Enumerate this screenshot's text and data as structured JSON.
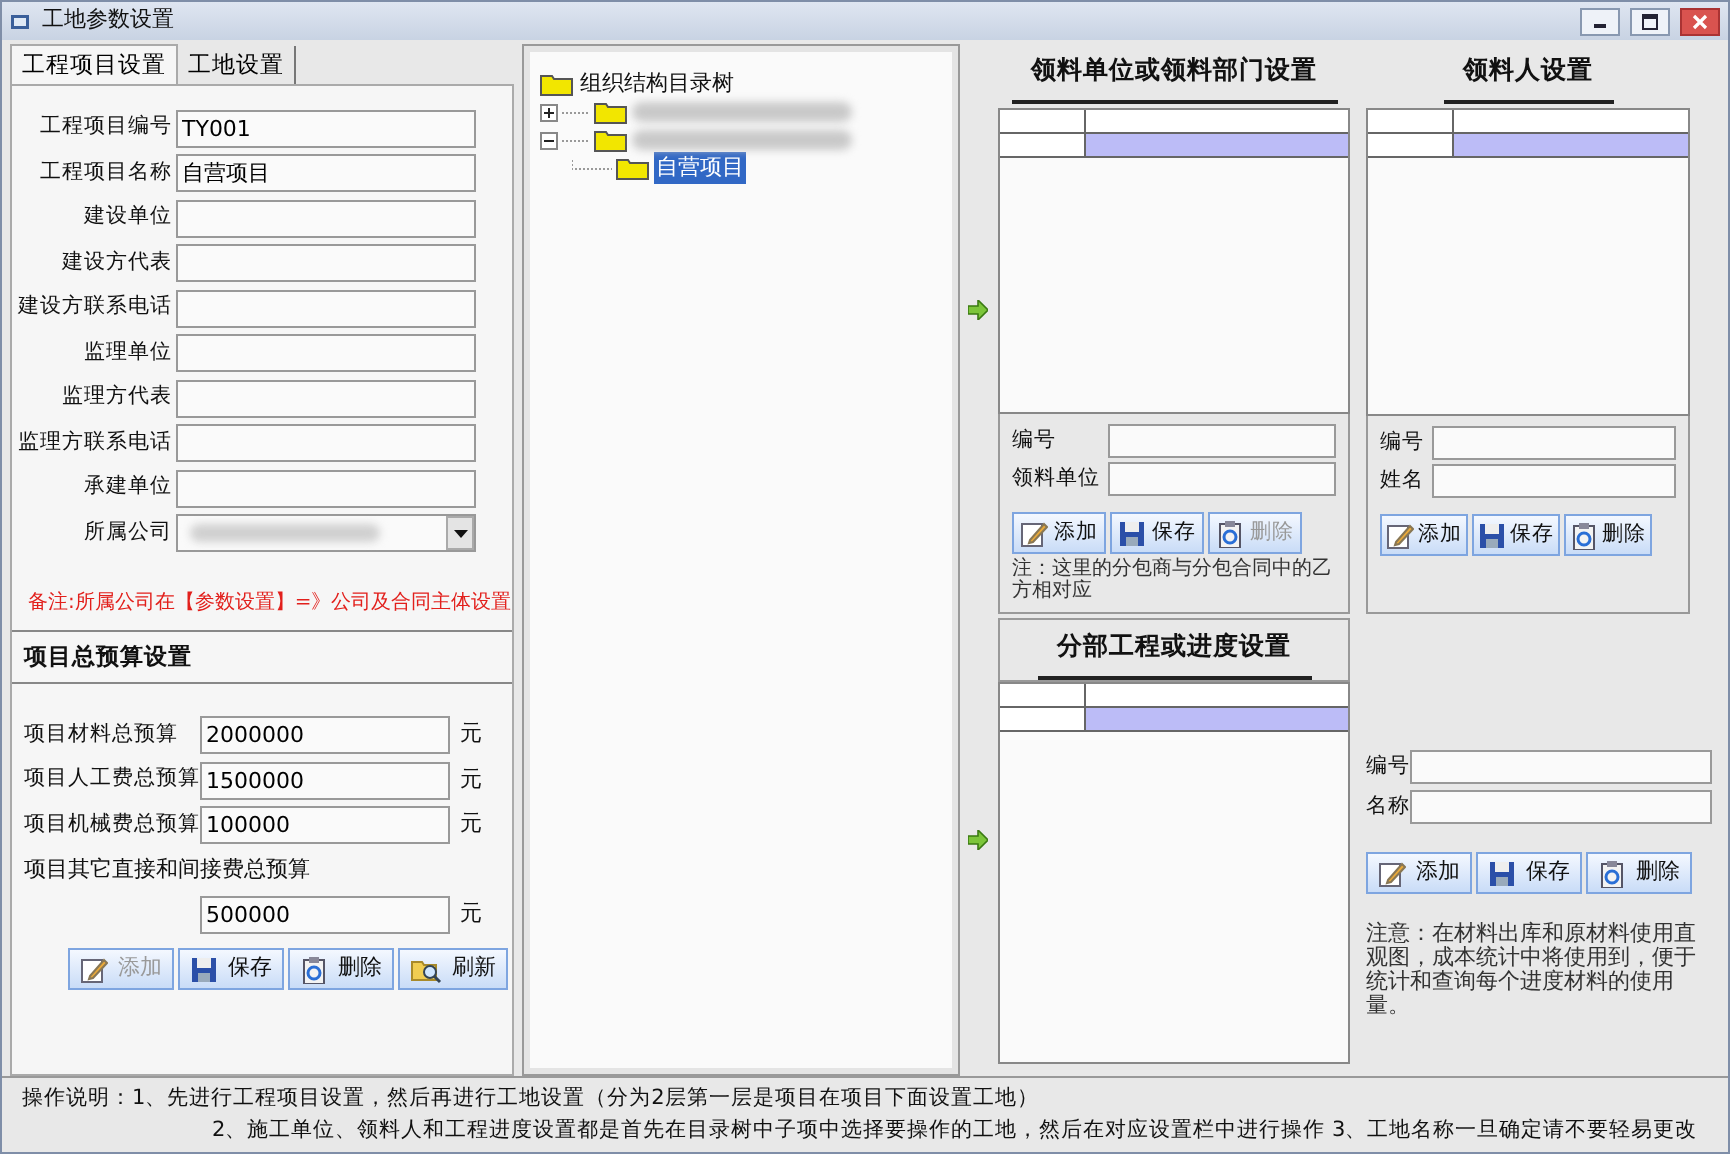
{
  "window": {
    "title": "工地参数设置"
  },
  "tabs": [
    {
      "label": "工程项目设置",
      "selected": true
    },
    {
      "label": "工地设置",
      "selected": false
    }
  ],
  "project_form": [
    {
      "label": "工程项目编号",
      "value": "TY001",
      "kind": "text"
    },
    {
      "label": "工程项目名称",
      "value": "自营项目",
      "kind": "text"
    },
    {
      "label": "建设单位",
      "kind": "text"
    },
    {
      "label": "建设方代表",
      "kind": "text"
    },
    {
      "label": "建设方联系电话",
      "kind": "text"
    },
    {
      "label": "监理单位",
      "kind": "text"
    },
    {
      "label": "监理方代表",
      "kind": "text"
    },
    {
      "label": "监理方联系电话",
      "kind": "text"
    },
    {
      "label": "承建单位",
      "kind": "text"
    },
    {
      "label": "所属公司",
      "kind": "select",
      "blurred": true
    }
  ],
  "company_note": "备注:所属公司在【参数设置】=》公司及合同主体设置",
  "budget": {
    "title": "项目总预算设置",
    "rows": [
      {
        "label": "项目材料总预算",
        "value": "2000000",
        "unit": "元",
        "kind": "inline"
      },
      {
        "label": "项目人工费总预算",
        "value": "1500000",
        "unit": "元",
        "kind": "inline"
      },
      {
        "label": "项目机械费总预算",
        "value": "100000",
        "unit": "元",
        "kind": "inline"
      },
      {
        "label": "项目其它直接和间接费总预算",
        "value": "500000",
        "unit": "元",
        "kind": "stacked"
      }
    ],
    "buttons": [
      {
        "label": "添加",
        "kind": "add",
        "disabled": true
      },
      {
        "label": "保存",
        "kind": "save",
        "disabled": false
      },
      {
        "label": "删除",
        "kind": "delete",
        "disabled": false
      },
      {
        "label": "刷新",
        "kind": "refresh",
        "disabled": false
      }
    ]
  },
  "tree": {
    "label": "组织结构目录树",
    "children": [
      {
        "kind": "blurred",
        "expanded": false,
        "selected": false
      },
      {
        "kind": "blurred",
        "expanded": true,
        "selected": false,
        "children": [
          {
            "label": "自营项目",
            "selected": true
          }
        ]
      }
    ]
  },
  "unit_section": {
    "title": "领料单位或领料部门设置",
    "grid": {
      "rows": [
        {
          "selected": true
        }
      ]
    },
    "fields": [
      {
        "label": "编号"
      },
      {
        "label": "领料单位"
      }
    ],
    "buttons": [
      {
        "label": "添加",
        "kind": "add",
        "disabled": false
      },
      {
        "label": "保存",
        "kind": "save",
        "disabled": false
      },
      {
        "label": "删除",
        "kind": "delete",
        "disabled": true
      }
    ],
    "note": "注：这里的分包商与分包合同中的乙方相对应"
  },
  "person_section": {
    "title": "领料人设置",
    "grid": {
      "rows": [
        {
          "selected": true
        }
      ]
    },
    "fields": [
      {
        "label": "编号"
      },
      {
        "label": "姓名"
      }
    ],
    "buttons": [
      {
        "label": "添加",
        "kind": "add",
        "disabled": false
      },
      {
        "label": "保存",
        "kind": "save",
        "disabled": false
      },
      {
        "label": "删除",
        "kind": "delete",
        "disabled": false
      }
    ]
  },
  "progress_section": {
    "title": "分部工程或进度设置",
    "grid": {
      "rows": [
        {
          "selected": true
        }
      ]
    },
    "fields": [
      {
        "label": "编号"
      },
      {
        "label": "名称"
      }
    ],
    "buttons": [
      {
        "label": "添加",
        "kind": "add",
        "disabled": false
      },
      {
        "label": "保存",
        "kind": "save",
        "disabled": false
      },
      {
        "label": "删除",
        "kind": "delete",
        "disabled": false
      }
    ],
    "note": "注意：在材料出库和原材料使用直观图，成本统计中将使用到，便于统计和查询每个进度材料的使用量。"
  },
  "instructions": [
    "操作说明：1、先进行工程项目设置，然后再进行工地设置（分为2层第一层是项目在项目下面设置工地）",
    "2、施工单位、领料人和工程进度设置都是首先在目录树中子项中选择要操作的工地，然后在对应设置栏中进行操作  3、工地名称一旦确定请不要轻易更改"
  ]
}
